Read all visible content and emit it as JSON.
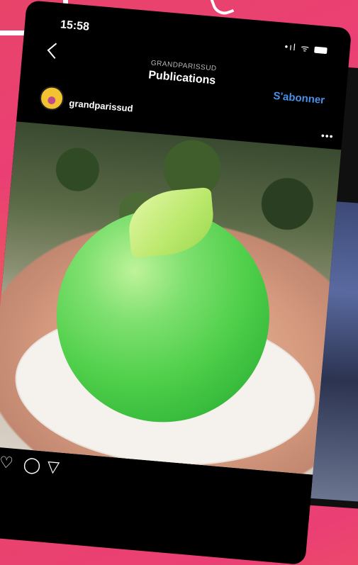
{
  "status_bar": {
    "time": "15:58",
    "signal_icons": "•ıl ᯤ"
  },
  "header": {
    "account_label": "GRANDPARISSUD",
    "title": "Publications",
    "follow_label": "S'abonner"
  },
  "post": {
    "username": "grandparissud",
    "more_icon": "•••"
  },
  "actions": {
    "like_icon": "♡",
    "comment_icon": "◯",
    "share_icon": "▽"
  },
  "colors": {
    "accent_blue": "#4a90e8",
    "background_pink": "#ea3f74",
    "background_orange": "#f58a2c"
  }
}
